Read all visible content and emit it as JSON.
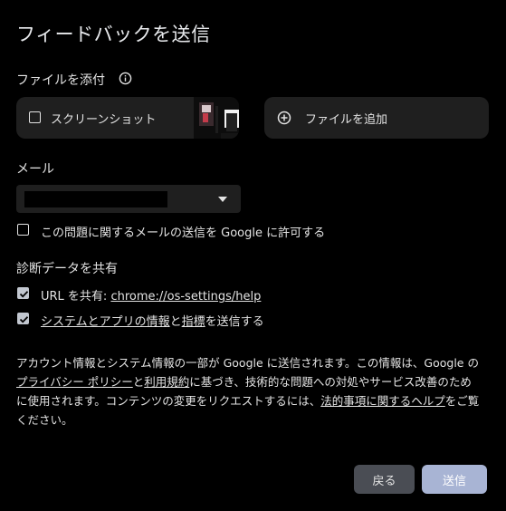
{
  "dialog": {
    "title": "フィードバックを送信"
  },
  "attach": {
    "label": "ファイルを添付",
    "info_icon": "info-icon",
    "screenshot": {
      "label": "スクリーンショット",
      "checked": false
    },
    "add_file": {
      "label": "ファイルを追加",
      "icon": "plus-circle-icon"
    }
  },
  "email": {
    "label": "メール",
    "value": "",
    "dropdown_icon": "caret-down-icon",
    "permission": {
      "label": "この問題に関するメールの送信を Google に許可する",
      "checked": false
    }
  },
  "diagnostics": {
    "label": "診断データを共有",
    "url": {
      "prefix": "URL を共有: ",
      "link": "chrome://os-settings/help",
      "checked": true
    },
    "system": {
      "link1": "システムとアプリの情報",
      "middle": "と",
      "link2": "指標",
      "suffix": "を送信する",
      "checked": true
    }
  },
  "footer": {
    "part1": "アカウント情報とシステム情報の一部が Google に送信されます。この情報は、Google の",
    "privacy_link": "プライバシー ポリシー",
    "part2": "と",
    "terms_link": "利用規約",
    "part3": "に基づき、技術的な問題への対処やサービス改善のために使用されます。コンテンツの変更をリクエストするには、",
    "legal_link": "法的事項に関するヘルプ",
    "part4": "をご覧ください。"
  },
  "buttons": {
    "back": "戻る",
    "send": "送信"
  },
  "colors": {
    "background": "#000000",
    "card": "#1f1f1f",
    "text": "#e3e3e3",
    "back_button": "#4a4d54",
    "send_button": "#a8b4d4"
  }
}
